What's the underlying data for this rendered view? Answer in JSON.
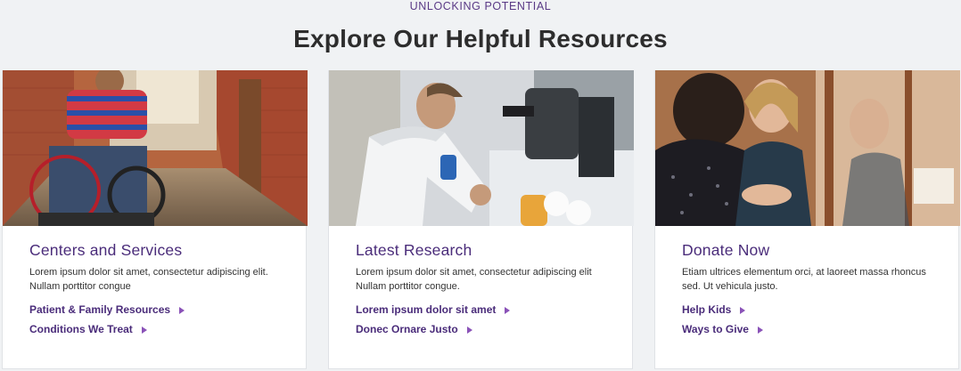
{
  "section": {
    "eyebrow": "UNLOCKING POTENTIAL",
    "title": "Explore Our Helpful Resources"
  },
  "cards": [
    {
      "image": "boy-in-wheelchair-photo",
      "title": "Centers and Services",
      "description": "Lorem ipsum dolor sit amet, consectetur adipiscing elit. Nullam porttitor congue",
      "links": [
        "Patient & Family Resources",
        "Conditions We Treat"
      ]
    },
    {
      "image": "researcher-at-microscope-photo",
      "title": "Latest Research",
      "description": "Lorem ipsum dolor sit amet, consectetur adipiscing elit Nullam porttitor congue.",
      "links": [
        "Lorem ipsum dolor sit amet",
        "Donec Ornare Justo"
      ]
    },
    {
      "image": "women-talking-photo",
      "title": "Donate Now",
      "description": "Etiam ultrices elementum orci, at laoreet massa rhoncus sed. Ut vehicula justo.",
      "links": [
        "Help Kids",
        "Ways to Give"
      ]
    }
  ],
  "colors": {
    "accent": "#4a2c7a",
    "arrow": "#8a52b8",
    "background": "#f0f2f4"
  }
}
